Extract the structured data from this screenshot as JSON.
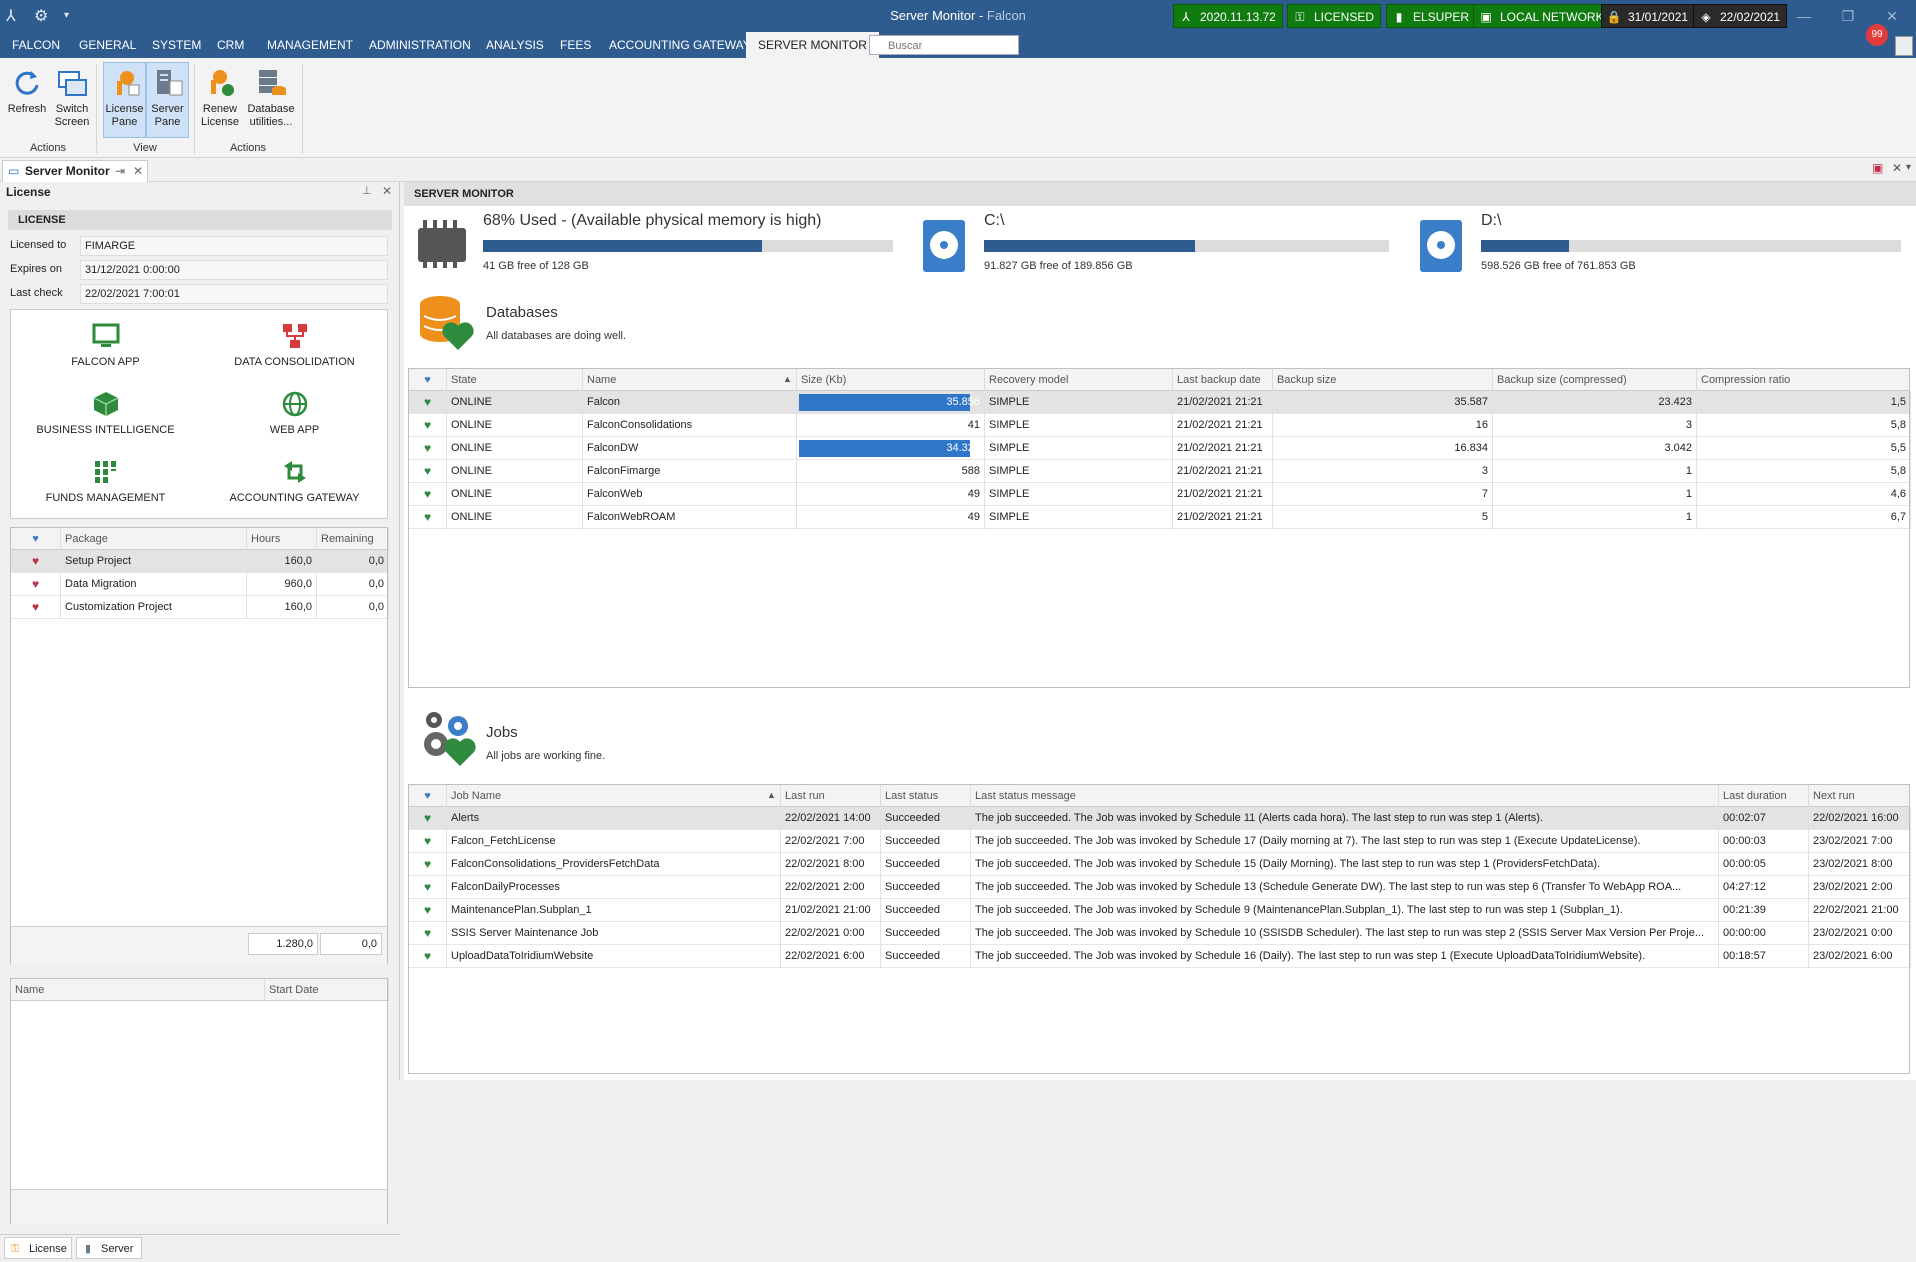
{
  "window": {
    "title": "Server Monitor",
    "subtitle": "Falcon"
  },
  "status_badges": [
    {
      "icon": "user-icon",
      "label": "2020.11.13.72",
      "style": "green"
    },
    {
      "icon": "key-icon",
      "label": "LICENSED",
      "style": "green"
    },
    {
      "icon": "phone-icon",
      "label": "ELSUPER",
      "style": "green"
    },
    {
      "icon": "network-icon",
      "label": "LOCAL NETWORK",
      "style": "green"
    },
    {
      "icon": "lock-icon",
      "label": "31/01/2021",
      "style": "dark"
    },
    {
      "icon": "box-icon",
      "label": "22/02/2021",
      "style": "dark"
    }
  ],
  "menu": {
    "tabs": [
      "FALCON",
      "GENERAL",
      "SYSTEM",
      "CRM",
      "MANAGEMENT",
      "ADMINISTRATION",
      "ANALYSIS",
      "FEES",
      "ACCOUNTING GATEWAY",
      "SERVER MONITOR"
    ],
    "active": "SERVER MONITOR",
    "search_placeholder": "Buscar",
    "notifications": "99"
  },
  "ribbon": {
    "buttons": [
      {
        "label": "Refresh",
        "group": "Actions"
      },
      {
        "label": "Switch Screen",
        "group": "Actions"
      },
      {
        "label": "License Pane",
        "group": "View",
        "selected": true
      },
      {
        "label": "Server Pane",
        "group": "View",
        "selected": true
      },
      {
        "label": "Renew License",
        "group": "Actions"
      },
      {
        "label": "Database utilities...",
        "group": "Actions"
      }
    ],
    "groups": [
      "Actions",
      "View",
      "Actions"
    ]
  },
  "doc_tab": {
    "label": "Server Monitor"
  },
  "license_panel": {
    "title": "License",
    "section": "LICENSE",
    "fields": [
      {
        "label": "Licensed to",
        "value": "FIMARGE"
      },
      {
        "label": "Expires on",
        "value": "31/12/2021 0:00:00"
      },
      {
        "label": "Last check",
        "value": "22/02/2021 7:00:01"
      }
    ],
    "modules": [
      {
        "label": "FALCON APP",
        "icon": "monitor-icon",
        "color": "#2e8b3e"
      },
      {
        "label": "DATA CONSOLIDATION",
        "icon": "consolidation-icon",
        "color": "#d63a3a"
      },
      {
        "label": "BUSINESS INTELLIGENCE",
        "icon": "cube-icon",
        "color": "#2e8b3e"
      },
      {
        "label": "WEB APP",
        "icon": "globe-icon",
        "color": "#2e8b3e"
      },
      {
        "label": "FUNDS MANAGEMENT",
        "icon": "funds-icon",
        "color": "#2e8b3e"
      },
      {
        "label": "ACCOUNTING GATEWAY",
        "icon": "gateway-icon",
        "color": "#2e8b3e"
      }
    ],
    "packages": {
      "columns": [
        "Package",
        "Hours",
        "Remaining"
      ],
      "rows": [
        {
          "name": "Setup Project",
          "hours": "160,0",
          "remaining": "0,0"
        },
        {
          "name": "Data Migration",
          "hours": "960,0",
          "remaining": "0,0"
        },
        {
          "name": "Customization Project",
          "hours": "160,0",
          "remaining": "0,0"
        }
      ],
      "total_hours": "1.280,0",
      "total_remaining": "0,0"
    },
    "sessions": {
      "columns": [
        "Name",
        "Start Date"
      ]
    },
    "bottom_tabs": [
      "License",
      "Server"
    ]
  },
  "server_monitor": {
    "title": "SERVER MONITOR",
    "memory": {
      "title": "68% Used - (Available physical memory is high)",
      "used_fraction": 0.68,
      "sub": "41 GB free of 128 GB"
    },
    "drives": [
      {
        "name": "C:\\",
        "used_fraction": 0.52,
        "sub": "91.827 GB free of 189.856 GB"
      },
      {
        "name": "D:\\",
        "used_fraction": 0.21,
        "sub": "598.526 GB free of 761.853 GB"
      }
    ],
    "databases": {
      "title": "Databases",
      "message": "All databases are doing well.",
      "columns": [
        "State",
        "Name",
        "Size (Kb)",
        "Recovery model",
        "Last backup date",
        "Backup size",
        "Backup size (compressed)",
        "Compression ratio"
      ],
      "rows": [
        {
          "state": "ONLINE",
          "name": "Falcon",
          "size": "35.856",
          "size_fraction": 0.93,
          "recovery": "SIMPLE",
          "last_backup": "21/02/2021 21:21",
          "backup_size": "35.587",
          "backup_compressed": "23.423",
          "ratio": "1,5"
        },
        {
          "state": "ONLINE",
          "name": "FalconConsolidations",
          "size": "41",
          "size_fraction": 0.0,
          "recovery": "SIMPLE",
          "last_backup": "21/02/2021 21:21",
          "backup_size": "16",
          "backup_compressed": "3",
          "ratio": "5,8"
        },
        {
          "state": "ONLINE",
          "name": "FalconDW",
          "size": "34.325",
          "size_fraction": 0.93,
          "recovery": "SIMPLE",
          "last_backup": "21/02/2021 21:21",
          "backup_size": "16.834",
          "backup_compressed": "3.042",
          "ratio": "5,5"
        },
        {
          "state": "ONLINE",
          "name": "FalconFimarge",
          "size": "588",
          "size_fraction": 0.0,
          "recovery": "SIMPLE",
          "last_backup": "21/02/2021 21:21",
          "backup_size": "3",
          "backup_compressed": "1",
          "ratio": "5,8"
        },
        {
          "state": "ONLINE",
          "name": "FalconWeb",
          "size": "49",
          "size_fraction": 0.0,
          "recovery": "SIMPLE",
          "last_backup": "21/02/2021 21:21",
          "backup_size": "7",
          "backup_compressed": "1",
          "ratio": "4,6"
        },
        {
          "state": "ONLINE",
          "name": "FalconWebROAM",
          "size": "49",
          "size_fraction": 0.0,
          "recovery": "SIMPLE",
          "last_backup": "21/02/2021 21:21",
          "backup_size": "5",
          "backup_compressed": "1",
          "ratio": "6,7"
        }
      ]
    },
    "jobs": {
      "title": "Jobs",
      "message": "All jobs are working fine.",
      "columns": [
        "Job Name",
        "Last run",
        "Last status",
        "Last status message",
        "Last duration",
        "Next run"
      ],
      "rows": [
        {
          "name": "Alerts",
          "last_run": "22/02/2021 14:00",
          "status": "Succeeded",
          "message": "The job succeeded.  The Job was invoked by Schedule 11 (Alerts cada hora).  The last step to run was step 1 (Alerts).",
          "duration": "00:02:07",
          "next_run": "22/02/2021 16:00"
        },
        {
          "name": "Falcon_FetchLicense",
          "last_run": "22/02/2021 7:00",
          "status": "Succeeded",
          "message": "The job succeeded.  The Job was invoked by Schedule 17 (Daily morning at 7).  The last step to run was step 1 (Execute UpdateLicense).",
          "duration": "00:00:03",
          "next_run": "23/02/2021 7:00"
        },
        {
          "name": "FalconConsolidations_ProvidersFetchData",
          "last_run": "22/02/2021 8:00",
          "status": "Succeeded",
          "message": "The job succeeded.  The Job was invoked by Schedule 15 (Daily Morning).  The last step to run was step 1 (ProvidersFetchData).",
          "duration": "00:00:05",
          "next_run": "23/02/2021 8:00"
        },
        {
          "name": "FalconDailyProcesses",
          "last_run": "22/02/2021 2:00",
          "status": "Succeeded",
          "message": "The job succeeded.  The Job was invoked by Schedule 13 (Schedule Generate  DW).  The last step to run was step 6 (Transfer To WebApp ROA...",
          "duration": "04:27:12",
          "next_run": "23/02/2021 2:00"
        },
        {
          "name": "MaintenancePlan.Subplan_1",
          "last_run": "21/02/2021 21:00",
          "status": "Succeeded",
          "message": "The job succeeded.  The Job was invoked by Schedule 9 (MaintenancePlan.Subplan_1).  The last step to run was step 1 (Subplan_1).",
          "duration": "00:21:39",
          "next_run": "22/02/2021 21:00"
        },
        {
          "name": "SSIS Server Maintenance Job",
          "last_run": "22/02/2021 0:00",
          "status": "Succeeded",
          "message": "The job succeeded.  The Job was invoked by Schedule 10 (SSISDB Scheduler).  The last step to run was step 2 (SSIS Server Max Version Per Proje...",
          "duration": "00:00:00",
          "next_run": "23/02/2021 0:00"
        },
        {
          "name": "UploadDataToIridiumWebsite",
          "last_run": "22/02/2021 6:00",
          "status": "Succeeded",
          "message": "The job succeeded.  The Job was invoked by Schedule 16 (Daily).  The last step to run was step 1 (Execute UploadDataToIridiumWebsite).",
          "duration": "00:18:57",
          "next_run": "23/02/2021 6:00"
        }
      ]
    }
  }
}
